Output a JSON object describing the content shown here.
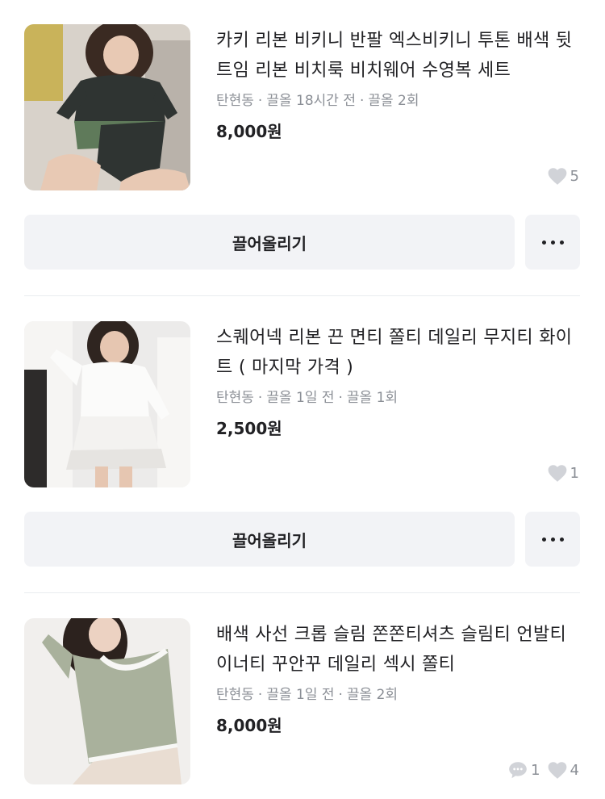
{
  "items": [
    {
      "title": "카키 리본 비키니 반팔 엑스비키니 투톤 배색 뒷트임 리본 비치룩 비치웨어 수영복 세트",
      "location": "탄현동",
      "bump_info": "끌올 18시간 전",
      "bump_count": "끌올 2회",
      "price": "8,000원",
      "likes": "5",
      "bump_button": "끌어올리기",
      "thumb_colors": {
        "bg": "#cfc7bd",
        "top": "#2f3432",
        "accent": "#5f7a5a",
        "skin": "#e8c9b4"
      }
    },
    {
      "title": "스퀘어넥 리본 끈 면티 쫄티 데일리 무지티 화이트 ( 마지막 가격 )",
      "location": "탄현동",
      "bump_info": "끌올 1일 전",
      "bump_count": "끌올 1회",
      "price": "2,500원",
      "likes": "1",
      "bump_button": "끌어올리기",
      "thumb_colors": {
        "bg": "#ecebea",
        "top": "#fbfbfa",
        "accent": "#dcdad6",
        "skin": "#e6c6b1"
      }
    },
    {
      "title": "배색 사선 크롭 슬림 쫀쫀티셔츠 슬림티 언발티 이너티 꾸안꾸 데일리 섹시 쫄티",
      "location": "탄현동",
      "bump_info": "끌올 1일 전",
      "bump_count": "끌올 2회",
      "price": "8,000원",
      "comments": "1",
      "likes": "4",
      "thumb_colors": {
        "bg": "#f1efed",
        "top": "#a9b19c",
        "accent": "#f7f7f5",
        "skin": "#ecd2c2"
      }
    }
  ]
}
